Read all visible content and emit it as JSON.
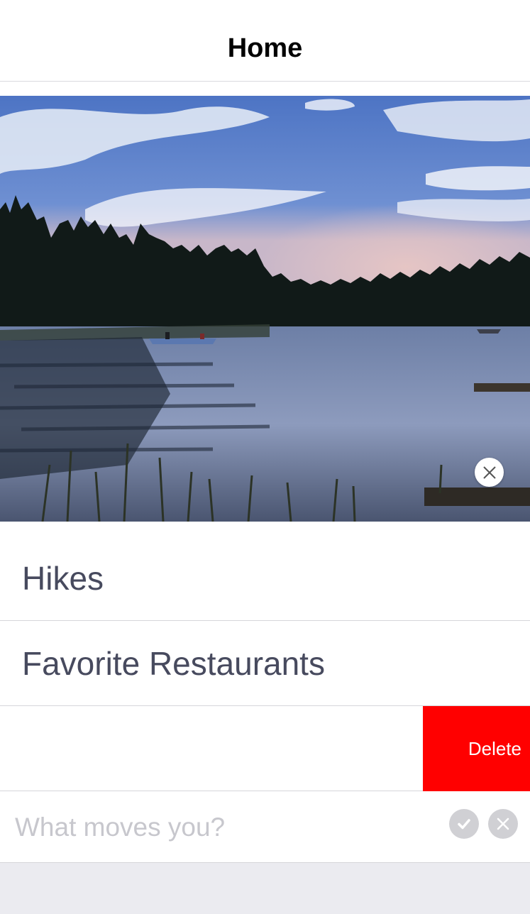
{
  "navbar": {
    "title": "Home"
  },
  "hero": {
    "description_icon": "close-icon"
  },
  "list": {
    "items": [
      {
        "label": "Hikes"
      },
      {
        "label": "Favorite Restaurants"
      }
    ],
    "swiped_row": {
      "delete_label": "Delete"
    }
  },
  "composer": {
    "placeholder": "What moves you?",
    "confirm_icon": "checkmark-icon",
    "cancel_icon": "close-icon"
  },
  "colors": {
    "delete": "#ff0000",
    "row_text": "#474a5e",
    "placeholder": "#c7c7cd",
    "footer": "#ebebf0"
  }
}
